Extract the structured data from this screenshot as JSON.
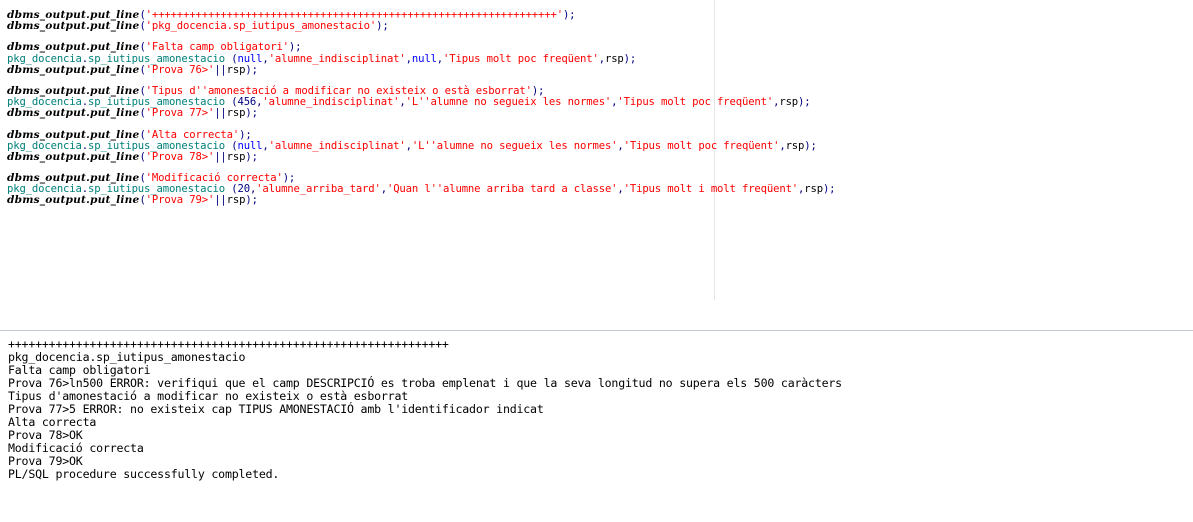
{
  "editor": {
    "blocks": [
      {
        "lines": [
          {
            "kind": "dbms",
            "text": "'+++++++++++++++++++++++++++++++++++++++++++++++++++++++++++++++++'"
          },
          {
            "kind": "dbms",
            "text": "'pkg_docencia.sp_iutipus_amonestacio'"
          }
        ]
      },
      {
        "lines": [
          {
            "kind": "dbms",
            "text": "'Falta camp obligatori'"
          },
          {
            "kind": "call",
            "args": [
              {
                "t": "null",
                "v": "null"
              },
              {
                "t": "p",
                "v": ","
              },
              {
                "t": "s",
                "v": "'alumne_indisciplinat'"
              },
              {
                "t": "p",
                "v": ","
              },
              {
                "t": "null",
                "v": "null"
              },
              {
                "t": "p",
                "v": ","
              },
              {
                "t": "s",
                "v": "'Tipus molt poc freqüent'"
              },
              {
                "t": "p",
                "v": ","
              },
              {
                "t": "b",
                "v": "rsp"
              }
            ]
          },
          {
            "kind": "prova",
            "text": "'Prova 76>'"
          }
        ]
      },
      {
        "lines": [
          {
            "kind": "dbms",
            "text": "'Tipus d''amonestació a modificar no existeix o està esborrat'"
          },
          {
            "kind": "call",
            "args": [
              {
                "t": "num",
                "v": "456"
              },
              {
                "t": "p",
                "v": ","
              },
              {
                "t": "s",
                "v": "'alumne_indisciplinat'"
              },
              {
                "t": "p",
                "v": ","
              },
              {
                "t": "s",
                "v": "'L''alumne no segueix les normes'"
              },
              {
                "t": "p",
                "v": ","
              },
              {
                "t": "s",
                "v": "'Tipus molt poc freqüent'"
              },
              {
                "t": "p",
                "v": ","
              },
              {
                "t": "b",
                "v": "rsp"
              }
            ]
          },
          {
            "kind": "prova",
            "text": "'Prova 77>'"
          }
        ]
      },
      {
        "lines": [
          {
            "kind": "dbms",
            "text": "'Alta correcta'"
          },
          {
            "kind": "call",
            "args": [
              {
                "t": "null",
                "v": "null"
              },
              {
                "t": "p",
                "v": ","
              },
              {
                "t": "s",
                "v": "'alumne_indisciplinat'"
              },
              {
                "t": "p",
                "v": ","
              },
              {
                "t": "s",
                "v": "'L''alumne no segueix les normes'"
              },
              {
                "t": "p",
                "v": ","
              },
              {
                "t": "s",
                "v": "'Tipus molt poc freqüent'"
              },
              {
                "t": "p",
                "v": ","
              },
              {
                "t": "b",
                "v": "rsp"
              }
            ]
          },
          {
            "kind": "prova",
            "text": "'Prova 78>'"
          }
        ]
      },
      {
        "lines": [
          {
            "kind": "dbms",
            "text": "'Modificació correcta'"
          },
          {
            "kind": "call",
            "args": [
              {
                "t": "num",
                "v": "20"
              },
              {
                "t": "p",
                "v": ","
              },
              {
                "t": "s",
                "v": "'alumne_arriba_tard'"
              },
              {
                "t": "p",
                "v": ","
              },
              {
                "t": "s",
                "v": "'Quan l''alumne arriba tard a classe'"
              },
              {
                "t": "p",
                "v": ","
              },
              {
                "t": "s",
                "v": "'Tipus molt i molt freqüent'"
              },
              {
                "t": "p",
                "v": ","
              },
              {
                "t": "b",
                "v": "rsp"
              }
            ]
          },
          {
            "kind": "prova",
            "text": "'Prova 79>'"
          }
        ]
      }
    ],
    "tokens": {
      "dbms_output": "dbms_output.put_line",
      "package": "pkg_docencia",
      "proc": "sp_iutipus_amonestacio",
      "concat": "||",
      "rsp": "rsp"
    }
  },
  "output": {
    "lines": [
      "+++++++++++++++++++++++++++++++++++++++++++++++++++++++++++++++++",
      "pkg_docencia.sp_iutipus_amonestacio",
      "Falta camp obligatori",
      "Prova 76>ln500 ERROR: verifiqui que el camp DESCRIPCIÓ es troba emplenat i que la seva longitud no supera els 500 caràcters",
      "Tipus d'amonestació a modificar no existeix o està esborrat",
      "Prova 77>5 ERROR: no existeix cap TIPUS AMONESTACIÓ amb l'identificador indicat",
      "Alta correcta",
      "Prova 78>OK",
      "Modificació correcta",
      "Prova 79>OK",
      "PL/SQL procedure successfully completed."
    ]
  },
  "colors": {
    "keyword": "#000000",
    "package": "#00807a",
    "string": "#ff0000",
    "number": "#000080",
    "null": "#0000ff",
    "punctuation": "#000080"
  }
}
